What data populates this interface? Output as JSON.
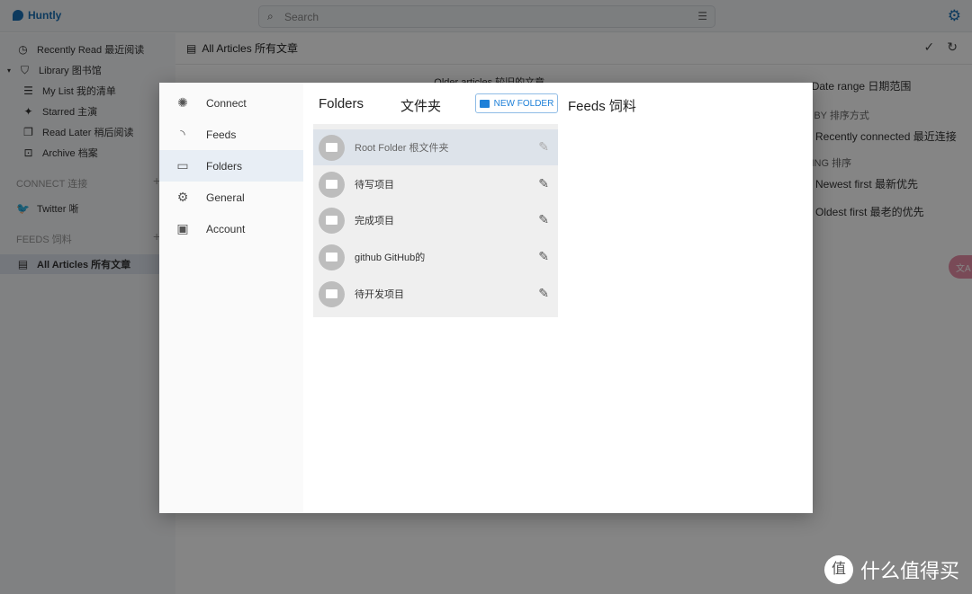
{
  "app": {
    "name": "Huntly",
    "search_placeholder": "Search"
  },
  "sidebar": {
    "items": [
      "Recently Read 最近阅读",
      "Library 图书馆",
      "My List 我的清单",
      "Starred 主演",
      "Read Later 稍后阅读",
      "Archive 档案"
    ],
    "connect_header": "CONNECT 连接",
    "connect_items": [
      "Twitter 唽"
    ],
    "feeds_header": "FEEDS 饲料",
    "feeds_items": [
      "All Articles 所有文章"
    ]
  },
  "main": {
    "title": "All Articles 所有文章",
    "older": "Older articles 较旧的文章",
    "right": {
      "date_range": "Date range 日期范围",
      "sort_by": "RT BY 排序方式",
      "sort_option": "Recently connected 最近连接",
      "sorting": "RTING 排序",
      "newest": "Newest first 最新优先",
      "oldest": "Oldest first 最老的优先"
    }
  },
  "modal": {
    "nav": [
      "Connect",
      "Feeds",
      "Folders",
      "General",
      "Account"
    ],
    "selected_nav": "Folders",
    "folders_title": "Folders",
    "folders_title_cn": "文件夹",
    "new_folder": "NEW FOLDER",
    "feeds_title": "Feeds 饲料",
    "folders": [
      "Root Folder 根文件夹",
      "待写项目",
      "完成项目",
      "github GitHub的",
      "待开发项目"
    ]
  },
  "watermark": "什么值得买",
  "colors": {
    "accent": "#1e80d8",
    "brand": "#1a6fb5"
  }
}
